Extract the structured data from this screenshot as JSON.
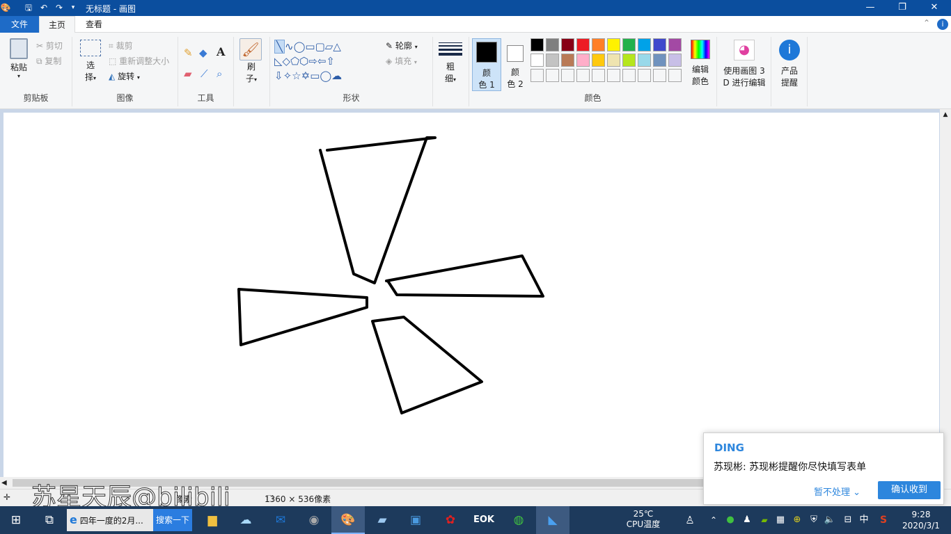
{
  "window": {
    "title": "无标题 - 画图",
    "minimize": "—",
    "maximize": "❐",
    "close": "✕"
  },
  "quick_access": [
    "save-icon",
    "undo-icon",
    "redo-icon",
    "customize-icon"
  ],
  "tabs": {
    "file": "文件",
    "home": "主页",
    "view": "查看"
  },
  "ribbon": {
    "clipboard": {
      "paste": "粘贴",
      "cut": "剪切",
      "copy": "复制",
      "label": "剪贴板"
    },
    "image": {
      "select1": "选",
      "select2": "择",
      "crop": "裁剪",
      "resize": "重新调整大小",
      "rotate": "旋转",
      "label": "图像"
    },
    "tools": {
      "label": "工具"
    },
    "brushes": {
      "l1": "刷",
      "l2": "子"
    },
    "shapes": {
      "outline": "轮廓",
      "fill": "填充",
      "label": "形状"
    },
    "size": {
      "l1": "粗",
      "l2": "细"
    },
    "color1": {
      "l1": "颜",
      "l2": "色 1"
    },
    "color2": {
      "l1": "颜",
      "l2": "色 2"
    },
    "edit_colors": {
      "l1": "编辑",
      "l2": "颜色"
    },
    "paint3d": {
      "l1": "使用画图 3",
      "l2": "D 进行编辑"
    },
    "product_alert": {
      "l1": "产品",
      "l2": "提醒"
    },
    "colors_label": "颜色",
    "palette_row1": [
      "#000000",
      "#7f7f7f",
      "#880015",
      "#ed1c24",
      "#ff7f27",
      "#fff200",
      "#22b14c",
      "#00a2e8",
      "#3f48cc",
      "#a349a4"
    ],
    "palette_row2": [
      "#ffffff",
      "#c3c3c3",
      "#b97a57",
      "#ffaec9",
      "#ffc90e",
      "#efe4b0",
      "#b5e61d",
      "#99d9ea",
      "#7092be",
      "#c8bfe7"
    ]
  },
  "status": {
    "size": "1360 × 536像素",
    "unit": "像素"
  },
  "notification": {
    "app": "DING",
    "message": "苏现彬: 苏现彬提醒你尽快填写表单",
    "ignore": "暂不处理",
    "confirm": "确认收到"
  },
  "taskbar": {
    "ie_item": "四年一度的2月...",
    "search_button": "搜索一下",
    "temp": "25℃",
    "temp_label": "CPU温度",
    "ime": "中",
    "time": "9:28",
    "date": "2020/3/1"
  },
  "watermark": "苏星天辰@bilibili"
}
